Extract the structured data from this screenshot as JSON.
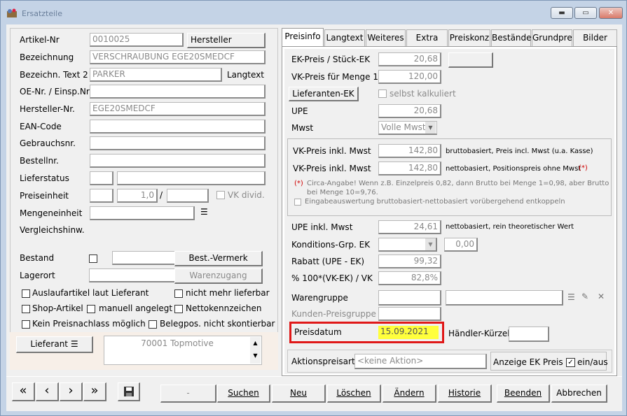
{
  "window": {
    "title": "Ersatzteile",
    "minimize": "▬",
    "maximize": "▭",
    "close": "✕"
  },
  "left": {
    "artikel_nr_label": "Artikel-Nr",
    "artikel_nr": "0010025",
    "hersteller_btn": "Hersteller",
    "bezeichnung_label": "Bezeichnung",
    "bezeichnung": "VERSCHRAUBUNG EGE20SMEDCF",
    "bez2_label": "Bezeichn. Text 2",
    "bez2": "PARKER",
    "langtext_label": "Langtext",
    "oe_label": "OE-Nr. / Einsp.Nr",
    "hersteller_nr_label": "Hersteller-Nr.",
    "hersteller_nr": "EGE20SMEDCF",
    "ean_label": "EAN-Code",
    "gebrauchsnr_label": "Gebrauchsnr.",
    "bestellnr_label": "Bestellnr.",
    "lieferstatus_label": "Lieferstatus",
    "preiseinheit_label": "Preiseinheit",
    "preiseinheit": "1,0",
    "slash": "/",
    "vk_divid_label": "VK divid.",
    "mengeneinheit_label": "Mengeneinheit",
    "vergleich_label": "Vergleichshinw.",
    "bestand_label": "Bestand",
    "best_vermerk_btn": "Best.-Vermerk",
    "lagerort_label": "Lagerort",
    "warenzugang_btn": "Warenzugang",
    "auslauf_label": "Auslaufartikel laut Lieferant",
    "nicht_mehr_label": "nicht mehr lieferbar",
    "shop_label": "Shop-Artikel",
    "manuell_label": "manuell angelegt",
    "netto_label": "Nettokennzeichen",
    "kein_preis_label": "Kein Preisnachlass möglich",
    "belegpos_label": "Belegpos. nicht skontierbar",
    "lieferant_btn": "Lieferant",
    "lieferant_value": "70001 Topmotive"
  },
  "tabs": [
    "Preisinfo",
    "Langtext",
    "Weiteres",
    "Extra",
    "Preiskonz",
    "Bestände",
    "Grundpre",
    "Bilder"
  ],
  "price": {
    "ek_label": "EK-Preis  / Stück-EK",
    "ek": "20,68",
    "vk_menge_label": "VK-Preis für Menge 1",
    "vk_menge": "120,00",
    "lieferanten_ek_btn": "Lieferanten-EK",
    "selbst_label": "selbst kalkuliert",
    "upe_label": "UPE",
    "upe": "20,68",
    "mwst_label": "Mwst",
    "mwst": "Volle Mwst",
    "vk_inkl_label": "VK-Preis inkl. Mwst",
    "vk_inkl_1": "142,80",
    "vk_inkl_1_note": "bruttobasiert, Preis incl. Mwst (u.a. Kasse)",
    "vk_inkl_2": "142,80",
    "vk_inkl_2_note": "nettobasiert, Positionspreis ohne Mwst",
    "star": "(*)",
    "circa_note": "Circa-Angabe! Wenn z.B. Einzelpreis 0,82, dann Brutto bei Menge 1=0,98, aber Brutto",
    "circa_note2": "bei Menge 10=9,76.",
    "entkoppeln_label": "Eingabeauswertung bruttobasiert-nettobasiert vorübergehend entkoppeln",
    "upe_inkl_label": "UPE inkl. Mwst",
    "upe_inkl": "24,61",
    "upe_inkl_note": "nettobasiert, rein theoretischer Wert",
    "konditions_label": "Konditions-Grp. EK",
    "konditions_val": "0,00",
    "rabatt_label": "Rabatt (UPE - EK)",
    "rabatt": "99,32",
    "prozent_label": "% 100*(VK-EK) / VK",
    "prozent": "82,8%",
    "warengruppe_label": "Warengruppe",
    "kunden_label": "Kunden-Preisgruppe",
    "preisdatum_label": "Preisdatum",
    "preisdatum": "15.09.2021",
    "haendler_label": "Händler-Kürzel",
    "aktion_label": "Aktionspreisart",
    "aktion": "<keine Aktion>",
    "anzeige_label": "Anzeige EK Preis",
    "einaus_label": "ein/aus"
  },
  "bottom": {
    "first": "«",
    "prev": "‹",
    "next": "›",
    "last": "»",
    "dash": "-",
    "suchen": "Suchen",
    "neu": "Neu",
    "loeschen": "Löschen",
    "aendern": "Ändern",
    "historie": "Historie",
    "beenden": "Beenden",
    "abbrechen": "Abbrechen"
  }
}
